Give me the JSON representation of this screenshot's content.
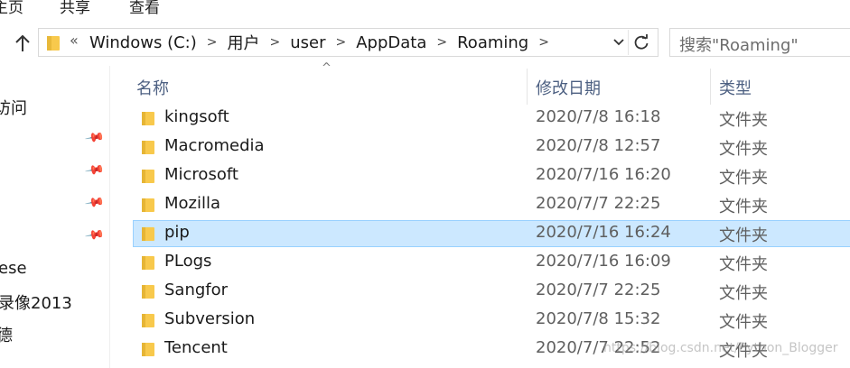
{
  "ribbon": {
    "tabs": [
      "主页",
      "共享",
      "查看"
    ]
  },
  "address_bar": {
    "overflow": "«",
    "crumbs": [
      "Windows (C:)",
      "用户",
      "user",
      "AppData",
      "Roaming"
    ],
    "dropdown_icon": "chevron-down-icon",
    "refresh_icon": "refresh-icon"
  },
  "search": {
    "placeholder": "搜索\"Roaming\""
  },
  "nav_pane": {
    "items": [
      "访问",
      "ese",
      "录像2013",
      "德"
    ]
  },
  "columns": {
    "name": "名称",
    "date": "修改日期",
    "type": "类型"
  },
  "files": [
    {
      "name": "kingsoft",
      "date": "2020/7/8 16:18",
      "type": "文件夹"
    },
    {
      "name": "Macromedia",
      "date": "2020/7/8 12:57",
      "type": "文件夹"
    },
    {
      "name": "Microsoft",
      "date": "2020/7/16 16:20",
      "type": "文件夹"
    },
    {
      "name": "Mozilla",
      "date": "2020/7/7 22:25",
      "type": "文件夹"
    },
    {
      "name": "pip",
      "date": "2020/7/16 16:24",
      "type": "文件夹"
    },
    {
      "name": "PLogs",
      "date": "2020/7/16 16:09",
      "type": "文件夹"
    },
    {
      "name": "Sangfor",
      "date": "2020/7/7 22:25",
      "type": "文件夹"
    },
    {
      "name": "Subversion",
      "date": "2020/7/8 15:32",
      "type": "文件夹"
    },
    {
      "name": "Tencent",
      "date": "2020/7/7 22:52",
      "type": "文件夹"
    }
  ],
  "selected_file": "pip",
  "watermark": "https://blog.csdn.net/Python_Blogger",
  "colors": {
    "selection_bg": "#cce8ff",
    "selection_border": "#99d1ff",
    "folder": "#f8c94c",
    "header_text": "#4d6082"
  }
}
